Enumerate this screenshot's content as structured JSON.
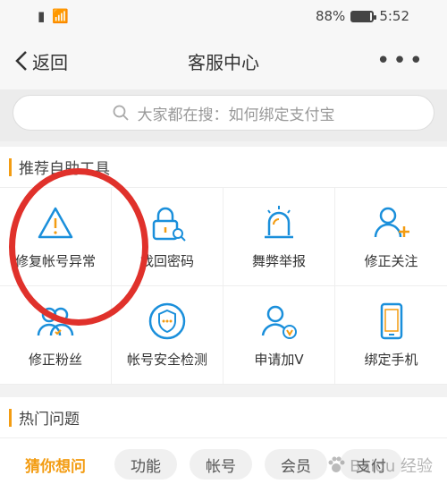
{
  "status": {
    "battery": "88%",
    "time": "5:52",
    "battery_level": 0.88
  },
  "nav": {
    "back_label": "返回",
    "title": "客服中心",
    "more": "•••"
  },
  "search": {
    "placeholder": "大家都在搜：如何绑定支付宝"
  },
  "tools_section": {
    "title": "推荐自助工具",
    "items": [
      {
        "label": "修复帐号异常",
        "icon": "warning-icon"
      },
      {
        "label": "找回密码",
        "icon": "lock-search-icon"
      },
      {
        "label": "舞弊举报",
        "icon": "alarm-icon"
      },
      {
        "label": "修正关注",
        "icon": "user-add-icon"
      },
      {
        "label": "修正粉丝",
        "icon": "users-icon"
      },
      {
        "label": "帐号安全检测",
        "icon": "shield-icon"
      },
      {
        "label": "申请加V",
        "icon": "user-verified-icon"
      },
      {
        "label": "绑定手机",
        "icon": "phone-icon"
      }
    ]
  },
  "hot_section": {
    "title": "热门问题",
    "chips": [
      "猜你想问",
      "功能",
      "帐号",
      "会员",
      "支付"
    ]
  },
  "colors": {
    "accent": "#f39c12",
    "icon_blue": "#1a8fdb",
    "annotation": "#e0312b"
  },
  "watermark": "Baidu 经验"
}
